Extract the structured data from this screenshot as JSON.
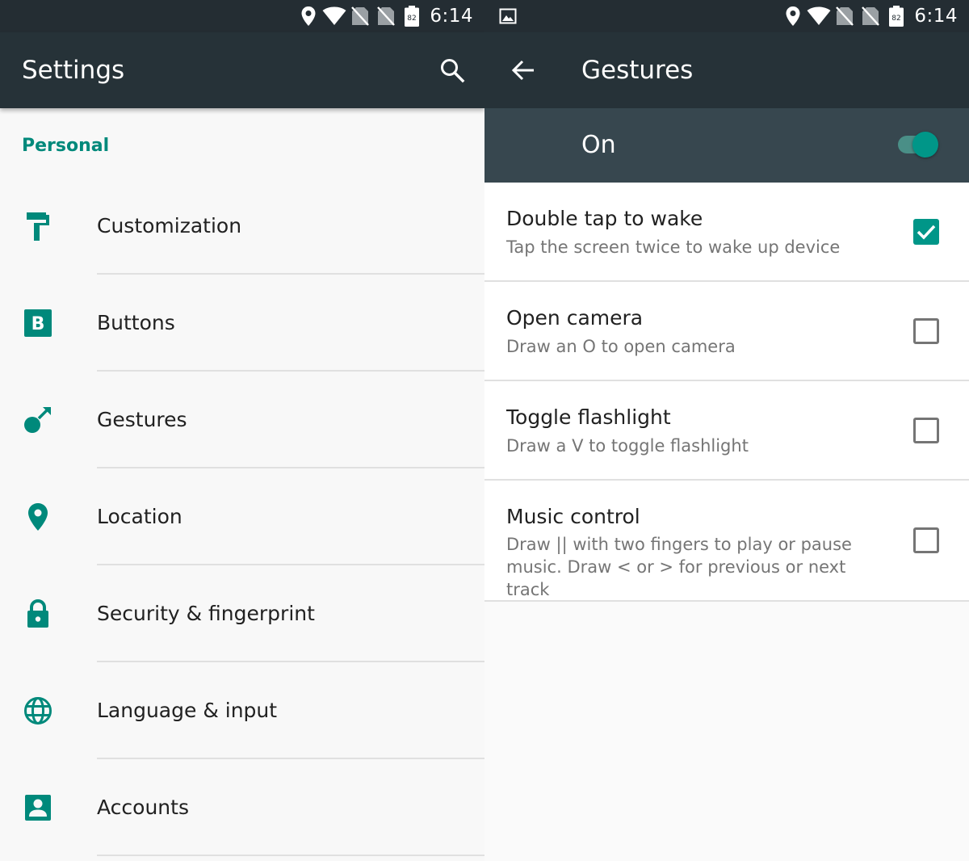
{
  "colors": {
    "accent": "#009688",
    "toolbar": "#263238",
    "status_bar": "#242d33",
    "master_bar": "#37474f"
  },
  "status_bar": {
    "time": "6:14",
    "battery_level": "82",
    "icons": [
      "location-icon",
      "wifi-icon",
      "no-sim-icon",
      "no-sim-icon",
      "battery-icon"
    ]
  },
  "left_screen": {
    "title": "Settings",
    "search_icon": "search-icon",
    "section_header": "Personal",
    "items": [
      {
        "label": "Customization",
        "icon": "paint-roller-icon"
      },
      {
        "label": "Buttons",
        "icon": "buttons-b-icon"
      },
      {
        "label": "Gestures",
        "icon": "gestures-icon"
      },
      {
        "label": "Location",
        "icon": "location-pin-icon"
      },
      {
        "label": "Security & fingerprint",
        "icon": "lock-icon"
      },
      {
        "label": "Language & input",
        "icon": "globe-icon"
      },
      {
        "label": "Accounts",
        "icon": "account-icon"
      }
    ]
  },
  "right_screen": {
    "title": "Gestures",
    "back_icon": "back-arrow-icon",
    "status_left_icon": "image-notification-icon",
    "master_switch": {
      "label": "On",
      "checked": true
    },
    "items": [
      {
        "title": "Double tap to wake",
        "summary": "Tap the screen twice to wake up device",
        "checked": true
      },
      {
        "title": "Open camera",
        "summary": "Draw an O to open camera",
        "checked": false
      },
      {
        "title": "Toggle flashlight",
        "summary": "Draw a V to toggle flashlight",
        "checked": false
      },
      {
        "title": "Music control",
        "summary": "Draw || with two fingers to play or pause music. Draw < or > for previous or next track",
        "checked": false
      }
    ]
  }
}
